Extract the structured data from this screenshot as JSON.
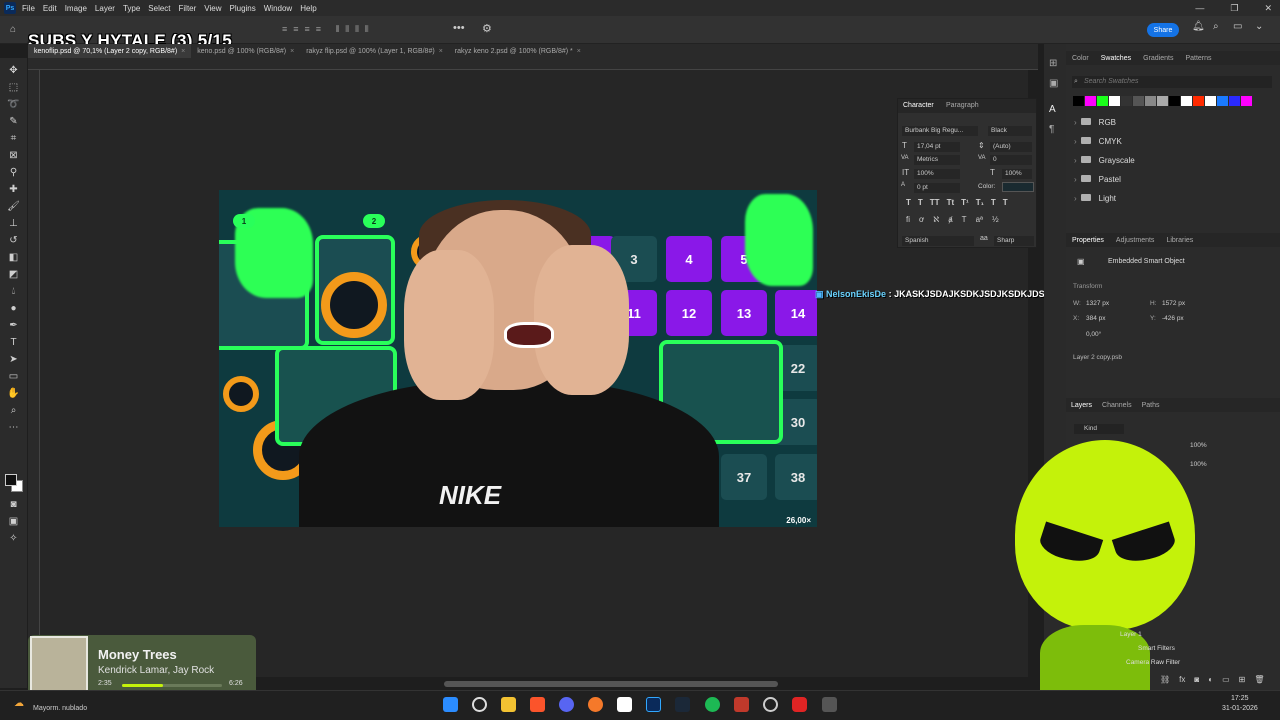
{
  "app": {
    "logo": "Ps",
    "menu": [
      "File",
      "Edit",
      "Image",
      "Layer",
      "Type",
      "Select",
      "Filter",
      "View",
      "Plugins",
      "Window",
      "Help"
    ],
    "share_label": "Share"
  },
  "overlay": {
    "stream_title": "SUBS Y HYTALE (3) 5/15"
  },
  "tabs": [
    {
      "label": "kenoflip.psd @ 70,1% (Layer 2 copy, RGB/8#)",
      "active": true
    },
    {
      "label": "keno.psd @ 100% (RGB/8#)",
      "active": false
    },
    {
      "label": "rakyz flip.psd @ 100% (Layer 1, RGB/8#)",
      "active": false
    },
    {
      "label": "rakyz keno 2.psd @ 100% (RGB/8#) *",
      "active": false
    }
  ],
  "canvas": {
    "tiles": [
      "3",
      "4",
      "5",
      "11",
      "12",
      "13",
      "14",
      "22",
      "30",
      "37",
      "38"
    ],
    "badges": [
      "1",
      "2"
    ],
    "multiplier": "26,00×",
    "shirt_logo": "NIKE"
  },
  "chat": {
    "user": "NelsonEkisDe",
    "message": ": JKASKJSDAJKSDKJSDJKSDKJDSKJ"
  },
  "character_panel": {
    "tabs": [
      "Character",
      "Paragraph"
    ],
    "font_family": "Burbank Big Regu...",
    "font_style": "Black",
    "font_size": "17,04 pt",
    "leading": "(Auto)",
    "kerning": "Metrics",
    "tracking": "0",
    "vert_scale": "100%",
    "horiz_scale": "100%",
    "baseline": "0 pt",
    "color_label": "Color:",
    "language": "Spanish",
    "antialias": "Sharp",
    "style_buttons": [
      "T",
      "T",
      "TT",
      "Tt",
      "T¹",
      "T₁",
      "T",
      "T"
    ]
  },
  "swatches_panel": {
    "tabs": [
      "Color",
      "Swatches",
      "Gradients",
      "Patterns"
    ],
    "search_placeholder": "Search Swatches",
    "colors": [
      "#000000",
      "#ff00ff",
      "#1aff1a",
      "#ffffff",
      "#333333",
      "#555555",
      "#888888",
      "#aaaaaa",
      "#000000",
      "#ffffff",
      "#ff2a00",
      "#ffffff",
      "#1a7aff",
      "#2a2aff",
      "#ff00ff"
    ],
    "folders": [
      "RGB",
      "CMYK",
      "Grayscale",
      "Pastel",
      "Light"
    ]
  },
  "properties_panel": {
    "tabs": [
      "Properties",
      "Adjustments",
      "Libraries"
    ],
    "type_label": "Embedded Smart Object",
    "section": "Transform",
    "w": "1327 px",
    "h": "1572 px",
    "x": "384 px",
    "y": "-426 px",
    "angle": "0,00°",
    "file_name": "Layer 2 copy.psb"
  },
  "layers_panel": {
    "tabs": [
      "Layers",
      "Channels",
      "Paths"
    ],
    "kind_label": "Kind",
    "opacity": "100%",
    "fill": "100%",
    "visible_rows": [
      "Layer 1",
      "Smart Filters",
      "Camera Raw Filter"
    ]
  },
  "music": {
    "title": "Money Trees",
    "artist": "Kendrick Lamar, Jay Rock",
    "elapsed": "2:35",
    "total": "6:26",
    "progress": 0.41
  },
  "taskbar": {
    "weather": "Mayorm. nublado",
    "time": "17:25",
    "date": "31-01-2026"
  }
}
